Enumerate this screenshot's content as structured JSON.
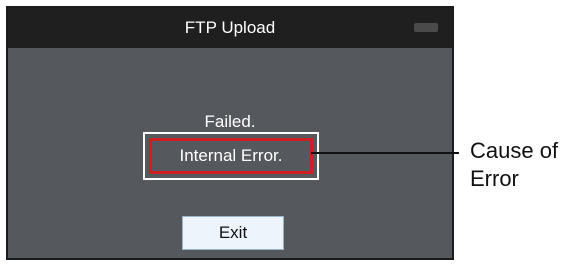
{
  "window": {
    "title": "FTP Upload",
    "battery_icon": "battery-icon"
  },
  "dialog": {
    "status": "Failed.",
    "error_detail": "Internal Error.",
    "exit_label": "Exit"
  },
  "callout": {
    "label_line1": "Cause of",
    "label_line2": "Error"
  },
  "colors": {
    "screen_bg": "#55585d",
    "titlebar_bg": "#1f1f1f",
    "error_highlight": "#d01d24",
    "button_bg": "#eef4fb"
  }
}
